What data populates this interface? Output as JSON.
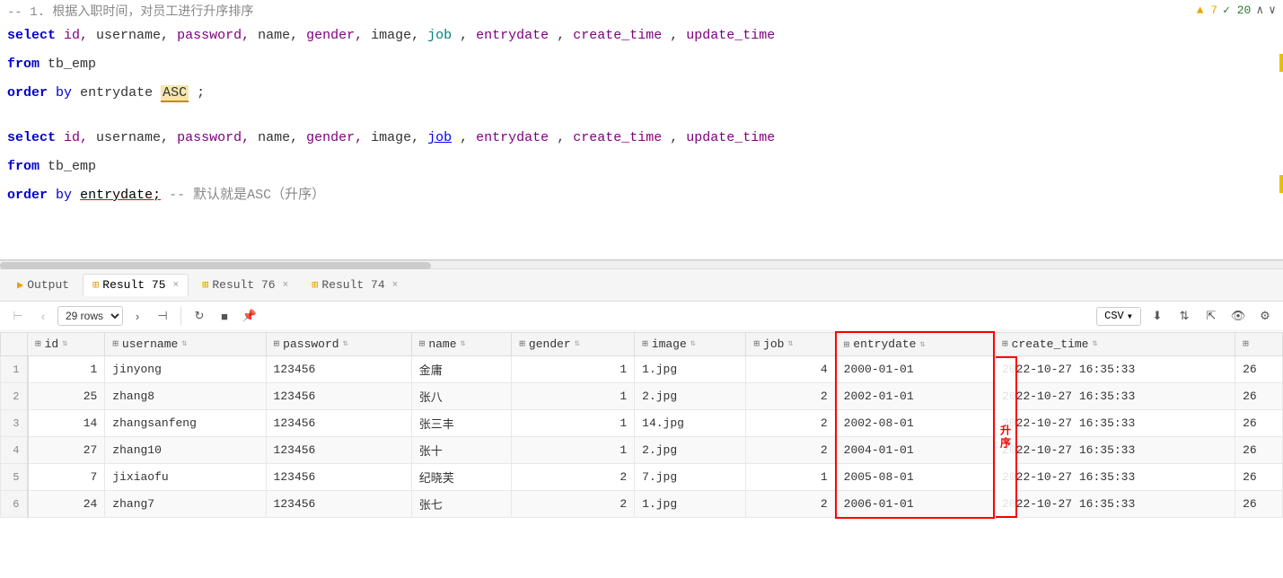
{
  "editor": {
    "comment1": "-- 1. 根据入职时间，对员工进行升序排序",
    "line1": "select id, username, password, name, gender, image, job, entrydate, create_time, update_time",
    "line2": "from tb_emp",
    "line3_pre": "order by entrydate ",
    "line3_asc": "ASC",
    "line3_semi": ";",
    "blank": "",
    "line4": "select id, username, password, name, gender, image, job, entrydate, create_time, update_time",
    "line5": "from tb_emp",
    "line6_pre": "order by  entrydate;",
    "line6_comment": "-- 默认就是ASC（升序）",
    "warnings": "▲ 7",
    "checks": "✓ 20",
    "nav_up": "∧",
    "nav_down": "∨"
  },
  "tabs": [
    {
      "id": "output",
      "label": "Output",
      "icon": "▶",
      "active": false,
      "closable": false
    },
    {
      "id": "result75",
      "label": "Result 75",
      "icon": "⊞",
      "active": true,
      "closable": true
    },
    {
      "id": "result76",
      "label": "Result 76",
      "icon": "⊞",
      "active": false,
      "closable": true
    },
    {
      "id": "result74",
      "label": "Result 74",
      "icon": "⊞",
      "active": false,
      "closable": true
    }
  ],
  "toolbar": {
    "rows_label": "29 rows",
    "csv_label": "CSV",
    "btn_first": "⊢",
    "btn_prev": "‹",
    "btn_next": "›",
    "btn_last": "⊣",
    "btn_refresh": "↻",
    "btn_stop": "■",
    "btn_pin": "🖈"
  },
  "columns": [
    {
      "id": "id",
      "label": "id"
    },
    {
      "id": "username",
      "label": "username"
    },
    {
      "id": "password",
      "label": "password"
    },
    {
      "id": "name",
      "label": "name"
    },
    {
      "id": "gender",
      "label": "gender"
    },
    {
      "id": "image",
      "label": "image"
    },
    {
      "id": "job",
      "label": "job"
    },
    {
      "id": "entrydate",
      "label": "entrydate"
    },
    {
      "id": "create_time",
      "label": "create_time"
    }
  ],
  "rows": [
    {
      "rownum": 1,
      "id": 1,
      "username": "jinyong",
      "password": "123456",
      "name": "金庸",
      "gender": 1,
      "image": "1.jpg",
      "job": 4,
      "entrydate": "2000-01-01",
      "create_time": "2022-10-27 16:35:33",
      "extra": "26"
    },
    {
      "rownum": 2,
      "id": 25,
      "username": "zhang8",
      "password": "123456",
      "name": "张八",
      "gender": 1,
      "image": "2.jpg",
      "job": 2,
      "entrydate": "2002-01-01",
      "create_time": "2022-10-27 16:35:33",
      "extra": "26"
    },
    {
      "rownum": 3,
      "id": 14,
      "username": "zhangsanfeng",
      "password": "123456",
      "name": "张三丰",
      "gender": 1,
      "image": "14.jpg",
      "job": 2,
      "entrydate": "2002-08-01",
      "create_time": "2022-10-27 16:35:33",
      "extra": "26"
    },
    {
      "rownum": 4,
      "id": 27,
      "username": "zhang10",
      "password": "123456",
      "name": "张十",
      "gender": 1,
      "image": "2.jpg",
      "job": 2,
      "entrydate": "2004-01-01",
      "create_time": "2022-10-27 16:35:33",
      "extra": "26"
    },
    {
      "rownum": 5,
      "id": 7,
      "username": "jixiaofu",
      "password": "123456",
      "name": "纪晓芙",
      "gender": 2,
      "image": "7.jpg",
      "job": 1,
      "entrydate": "2005-08-01",
      "create_time": "2022-10-27 16:35:33",
      "extra": "26"
    },
    {
      "rownum": 6,
      "id": 24,
      "username": "zhang7",
      "password": "123456",
      "name": "张七",
      "gender": 2,
      "image": "1.jpg",
      "job": 2,
      "entrydate": "2006-01-01",
      "create_time": "2022-10-27 16:35:33",
      "extra": "26"
    }
  ],
  "ascending_label": "升序"
}
